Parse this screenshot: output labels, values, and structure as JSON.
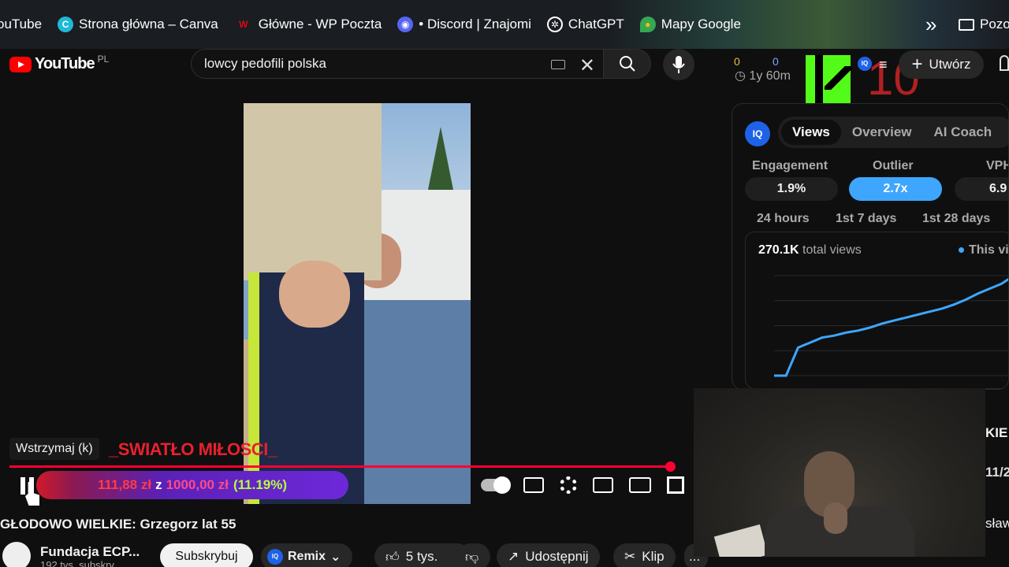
{
  "bookmarks": [
    {
      "label": "ouTube",
      "icon": "youtube-icon"
    },
    {
      "label": "Strona główna – Canva",
      "icon": "canva-icon"
    },
    {
      "label": "Główne - WP Poczta",
      "icon": "wp-icon"
    },
    {
      "label": "• Discord | Znajomi",
      "icon": "discord-icon"
    },
    {
      "label": "ChatGPT",
      "icon": "chatgpt-icon"
    },
    {
      "label": "Mapy Google",
      "icon": "maps-pin-icon"
    }
  ],
  "bookmarks_more": "»",
  "bookmarks_folder": "Pozo",
  "header": {
    "logo_text": "YouTube",
    "country": "PL",
    "search_value": "lowcy pedofili polska",
    "create_label": "Utwórz"
  },
  "stats": {
    "left_value": "0",
    "right_value": "0",
    "time_label": "1y 60m"
  },
  "overlay": {
    "number": "10",
    "kick_brand_color": "#53fc18"
  },
  "player": {
    "tooltip": "Wstrzymaj (k)",
    "overlay_title": "_SWIATŁO MIŁOSCI_",
    "donation_amount": "111,88 zł",
    "donation_sep": "z",
    "donation_goal": "1000,00 zł",
    "donation_percent": "(11.19%)",
    "progress_fraction": 0.98
  },
  "video": {
    "title": "GŁODOWO WIELKIE: Grzegorz lat 55",
    "channel": "Fundacja ECP...",
    "subscribers": "192 tys. subskry",
    "subscribe_label": "Subskrybuj",
    "remix_label": "Remix",
    "likes": "5 tys.",
    "share_label": "Udostępnij",
    "clip_label": "Klip",
    "more_label": "..."
  },
  "vidiq": {
    "logo": "IQ",
    "tabs": [
      "Views",
      "Overview",
      "AI Coach"
    ],
    "active_tab": "Views",
    "metrics": [
      {
        "label": "Engagement",
        "value": "1.9%"
      },
      {
        "label": "Outlier",
        "value": "2.7x"
      },
      {
        "label": "VPH",
        "value": "6.9"
      }
    ],
    "ranges": [
      "24 hours",
      "1st 7 days",
      "1st 28 days"
    ],
    "total_views": "270.1K",
    "total_views_label": "total views",
    "legend": "This vi",
    "line_color": "#3ea6ff"
  },
  "chart_data": {
    "type": "line",
    "series": [
      {
        "name": "This vi",
        "values": [
          0,
          0,
          0.28,
          0.33,
          0.38,
          0.4,
          0.43,
          0.45,
          0.48,
          0.52,
          0.55,
          0.58,
          0.61,
          0.64,
          0.67,
          0.71,
          0.76,
          0.82,
          0.87,
          0.92,
          1.0
        ]
      }
    ]
  },
  "side": {
    "text_a": "KIE:",
    "text_b": "11/2",
    "text_c": "sław"
  }
}
